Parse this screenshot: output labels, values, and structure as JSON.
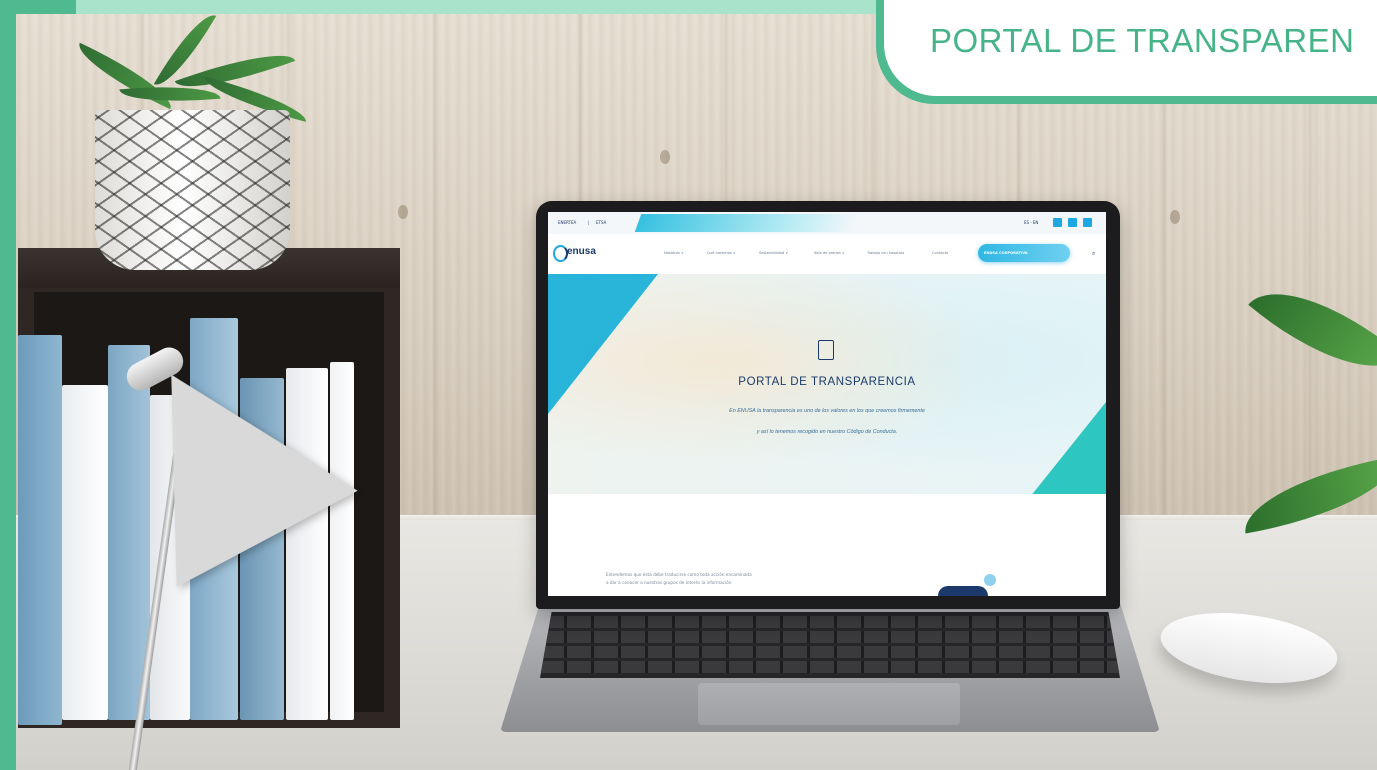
{
  "banner": {
    "title": "PORTAL DE TRANSPAREN"
  },
  "laptop_screen": {
    "topbar": {
      "left_links": [
        "ENERTEA",
        "|",
        "ETSA"
      ],
      "lang": "ES · EN"
    },
    "logo": "enusa",
    "nav_items": [
      "Nosotros ∨",
      "Qué hacemos ∨",
      "Sostenibilidad ∨",
      "Sala de prensa ∨",
      "Trabaja con nosotros",
      "Contacto"
    ],
    "nav_button": "ENUSA CORPORATIVA",
    "hero": {
      "title": "PORTAL DE TRANSPARENCIA",
      "line1": "En ENUSA la transparencia es uno de los valores en los que creemos firmemente",
      "line2": "y así lo tenemos recogido en nuestro Código de Conducta."
    },
    "lower": {
      "line1": "Entendemos que ésta debe traducirse como toda acción encaminada",
      "line2": "a dar a conocer a nuestros grupos de interés la información"
    }
  },
  "colors": {
    "brand_green": "#4fba8f",
    "light_green": "#a9e3cc",
    "site_blue": "#1ea7e0",
    "navy": "#1b3a6b"
  },
  "icons": [
    "search-icon",
    "twitter-icon",
    "linkedin-icon",
    "youtube-icon",
    "building-icon",
    "lightbulb-icon"
  ]
}
